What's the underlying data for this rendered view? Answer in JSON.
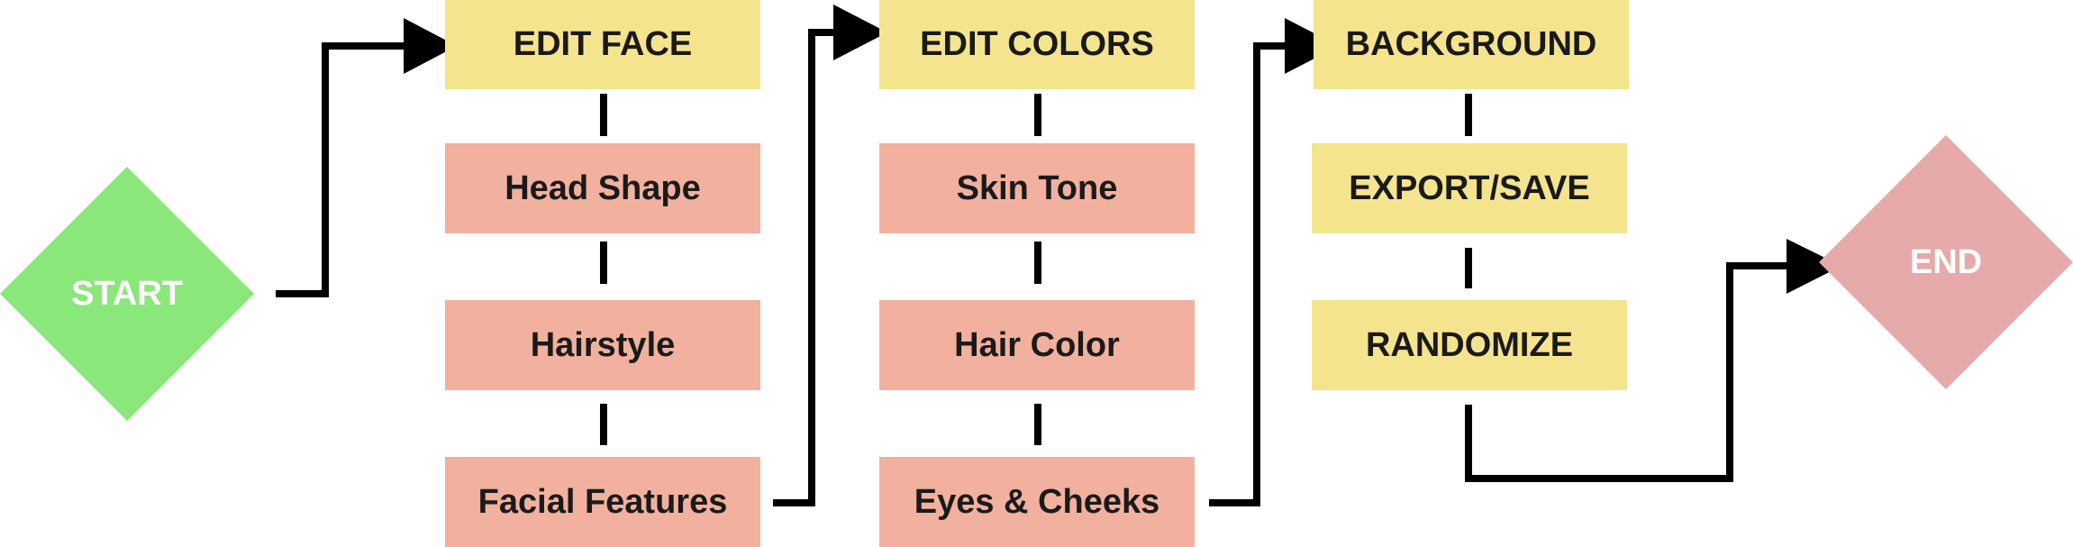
{
  "nodes": {
    "start": "START",
    "end": "END",
    "face": {
      "title": "EDIT FACE",
      "items": [
        "Head Shape",
        "Hairstyle",
        "Facial Features"
      ]
    },
    "colors": {
      "title": "EDIT COLORS",
      "items": [
        "Skin Tone",
        "Hair Color",
        "Eyes & Cheeks"
      ]
    },
    "output": {
      "title": "BACKGROUND",
      "items": [
        "EXPORT/SAVE",
        "RANDOMIZE"
      ]
    }
  },
  "colors": {
    "start_fill": "#8ae77a",
    "end_fill": "#e5aaa9",
    "header_fill": "#f5e48e",
    "step_fill": "#f2b19e",
    "line": "#000000"
  }
}
